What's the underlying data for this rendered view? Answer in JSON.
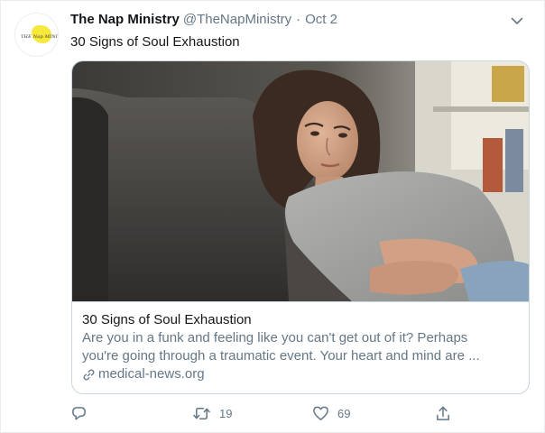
{
  "tweet": {
    "author_name": "The Nap Ministry",
    "handle": "@TheNapMinistry",
    "separator": "·",
    "date": "Oct 2",
    "text": "30 Signs of Soul Exhaustion",
    "avatar_logo_text": "The Nap Ministry"
  },
  "card": {
    "title": "30 Signs of Soul Exhaustion",
    "description_line1": "Are you in a funk and feeling like you can't get out of it? Perhaps",
    "description_line2": "you're going through a traumatic event. Your heart and mind are ...",
    "domain": "medical-news.org"
  },
  "actions": {
    "reply_count": "",
    "retweet_count": "19",
    "like_count": "69"
  },
  "icons": {
    "caret": "chevron-down-icon",
    "reply": "reply-icon",
    "retweet": "retweet-icon",
    "like": "heart-icon",
    "share": "share-icon",
    "link": "link-icon"
  },
  "colors": {
    "text_primary": "#14171a",
    "text_secondary": "#657786",
    "border": "#ccd6dd",
    "avatar_accent": "#f7e83c"
  }
}
